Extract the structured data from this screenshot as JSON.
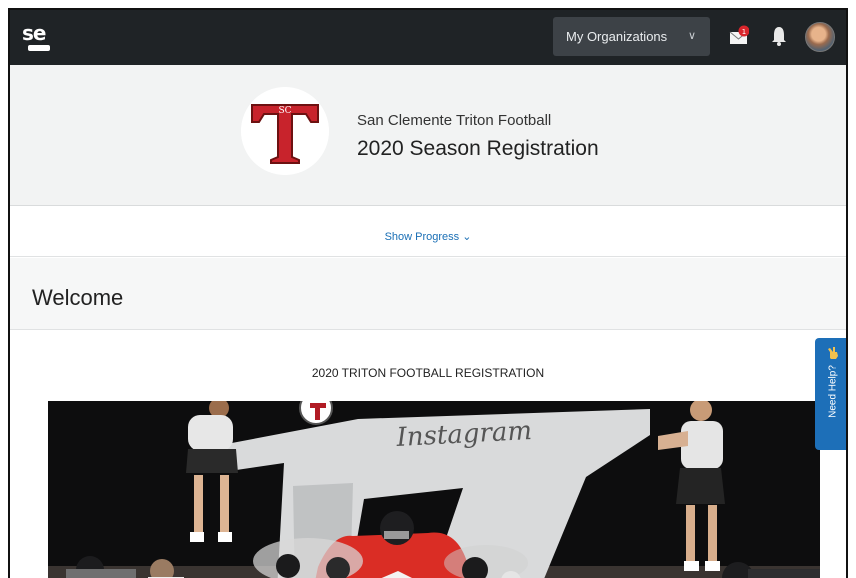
{
  "nav": {
    "my_organizations": "My Organizations",
    "mail_badge": "1"
  },
  "header": {
    "org_name": "San Clemente Triton Football",
    "registration_title": "2020 Season Registration"
  },
  "progress": {
    "label": "Show Progress"
  },
  "page": {
    "welcome": "Welcome",
    "section_title": "2020 TRITON FOOTBALL REGISTRATION"
  },
  "photo": {
    "banner_text": "Instagram"
  },
  "help": {
    "label": "Need Help?"
  },
  "colors": {
    "nav_bg": "#1f2326",
    "brand_red": "#c8232c",
    "link_blue": "#1a6fb5",
    "help_blue": "#1d6fb8"
  }
}
